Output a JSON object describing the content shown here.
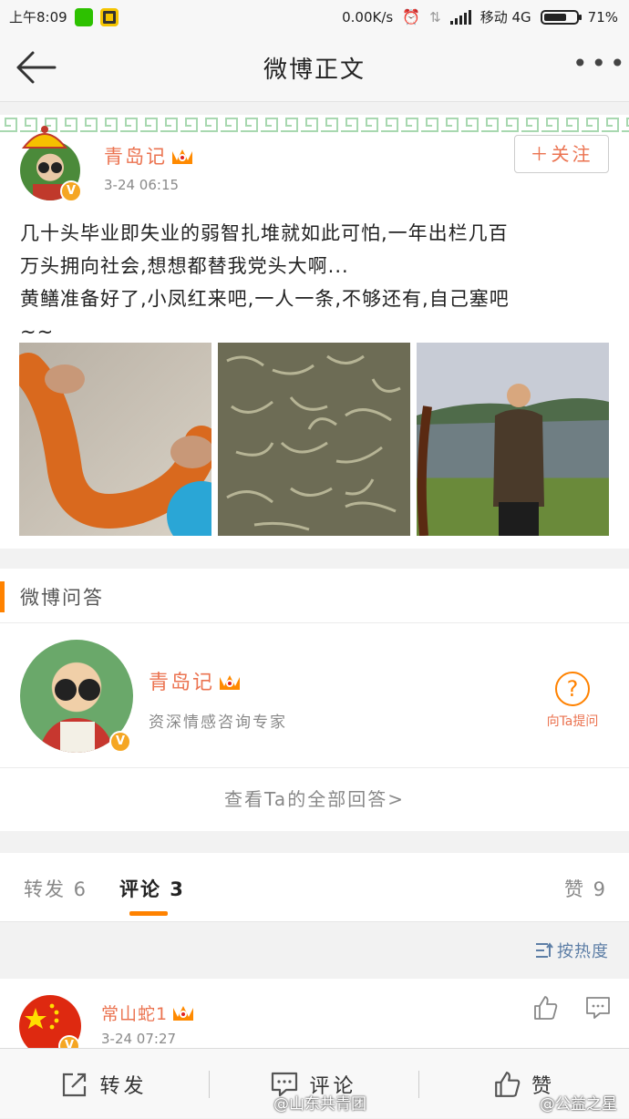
{
  "status_bar": {
    "time": "上午8:09",
    "net_speed": "0.00K/s",
    "carrier": "移动 4G",
    "battery": "71%",
    "battery_level": 0.71
  },
  "nav": {
    "title": "微博正文"
  },
  "post": {
    "author": "青岛记",
    "time": "3-24 06:15",
    "follow_label": "关注",
    "text_lines": [
      "几十头毕业即失业的弱智扎堆就如此可怕,一年出栏几百",
      "万头拥向社会,想想都替我党头大啊...",
      "黄鳝准备好了,小凤红来吧,一人一条,不够还有,自己塞吧",
      "~~"
    ]
  },
  "qa": {
    "section_title": "微博问答",
    "name": "青岛记",
    "desc": "资深情感咨询专家",
    "ask_label": "向Ta提问",
    "view_all": "查看Ta的全部回答>"
  },
  "tabs": {
    "repost": "转发 6",
    "comment": "评论 3",
    "like": "赞 9"
  },
  "sort_label": "按热度",
  "comment": {
    "author": "常山蛇1",
    "time": "3-24 07:27"
  },
  "bottom": {
    "repost": "转发",
    "comment": "评论",
    "like": "赞"
  },
  "watermarks": {
    "left": "@山东共青团",
    "right": "@公益之星"
  },
  "colors": {
    "accent_orange": "#ff8200",
    "username": "#eb7350",
    "link_blue": "#5d7ea6"
  }
}
